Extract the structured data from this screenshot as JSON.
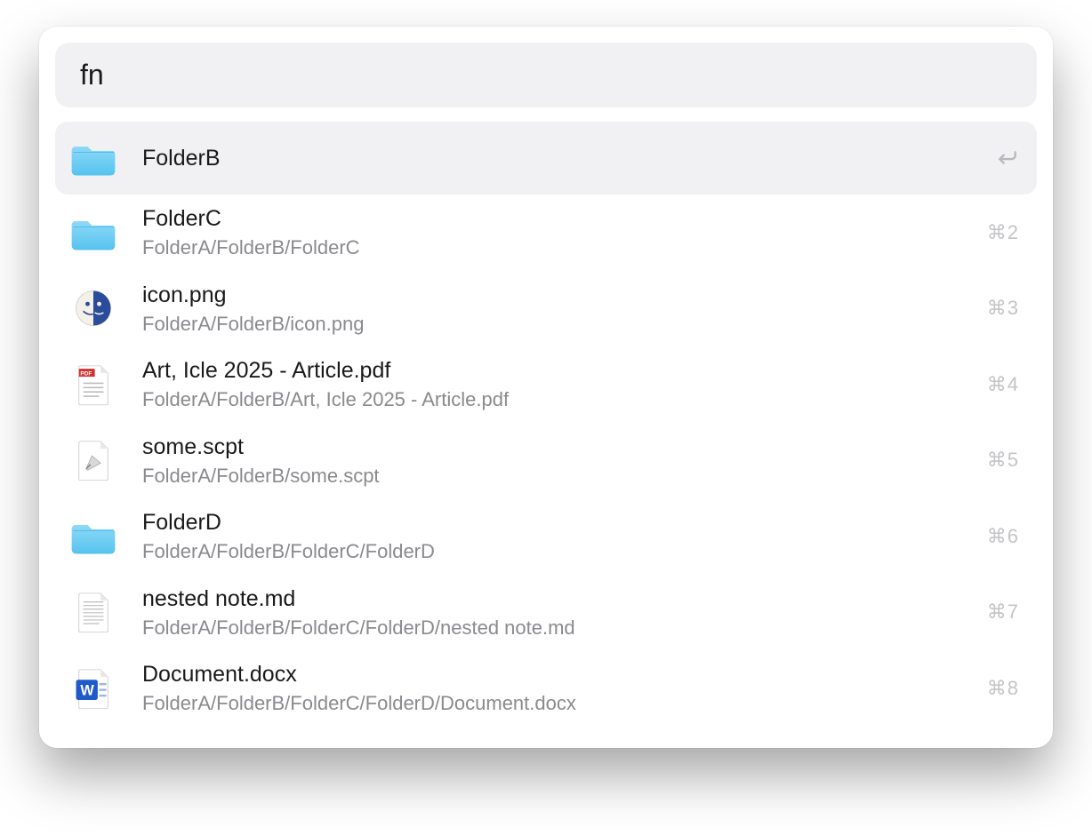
{
  "search": {
    "value": "fn"
  },
  "enter_glyph": "↩",
  "cmd_glyph": "⌘",
  "results": [
    {
      "icon": "folder",
      "title": "FolderB",
      "subtitle": "",
      "shortcut_kind": "enter",
      "shortcut_num": "",
      "selected": true
    },
    {
      "icon": "folder",
      "title": "FolderC",
      "subtitle": "FolderA/FolderB/FolderC",
      "shortcut_kind": "cmd",
      "shortcut_num": "2",
      "selected": false
    },
    {
      "icon": "png",
      "title": "icon.png",
      "subtitle": "FolderA/FolderB/icon.png",
      "shortcut_kind": "cmd",
      "shortcut_num": "3",
      "selected": false
    },
    {
      "icon": "pdf",
      "title": "Art, Icle 2025 - Article.pdf",
      "subtitle": "FolderA/FolderB/Art, Icle 2025 - Article.pdf",
      "shortcut_kind": "cmd",
      "shortcut_num": "4",
      "selected": false
    },
    {
      "icon": "scpt",
      "title": "some.scpt",
      "subtitle": "FolderA/FolderB/some.scpt",
      "shortcut_kind": "cmd",
      "shortcut_num": "5",
      "selected": false
    },
    {
      "icon": "folder",
      "title": "FolderD",
      "subtitle": "FolderA/FolderB/FolderC/FolderD",
      "shortcut_kind": "cmd",
      "shortcut_num": "6",
      "selected": false
    },
    {
      "icon": "md",
      "title": "nested note.md",
      "subtitle": "FolderA/FolderB/FolderC/FolderD/nested note.md",
      "shortcut_kind": "cmd",
      "shortcut_num": "7",
      "selected": false
    },
    {
      "icon": "docx",
      "title": "Document.docx",
      "subtitle": "FolderA/FolderB/FolderC/FolderD/Document.docx",
      "shortcut_kind": "cmd",
      "shortcut_num": "8",
      "selected": false
    }
  ]
}
